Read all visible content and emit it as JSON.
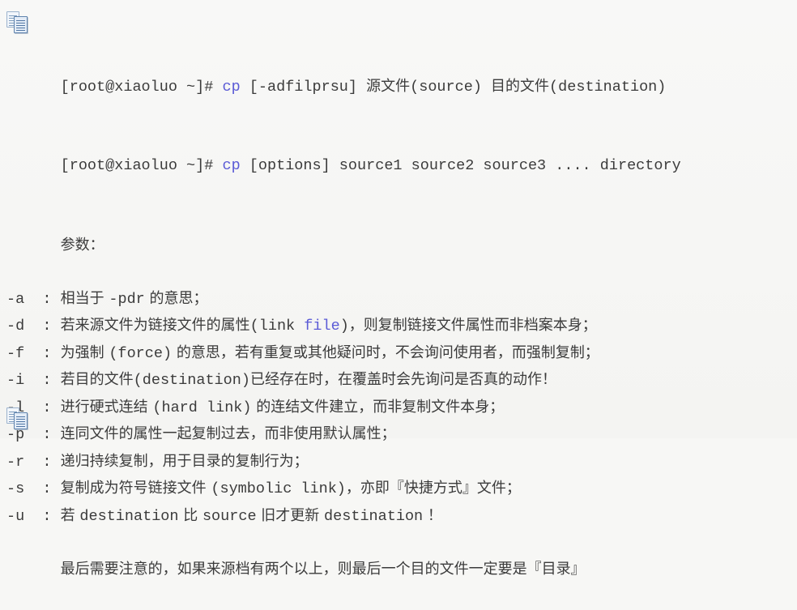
{
  "icons": {
    "top": "copy-icon",
    "bottom": "copy-icon"
  },
  "command_lines": [
    {
      "prompt": "[root@xiaoluo ~]# ",
      "command": "cp",
      "args_mono": " [-adfilprsu] ",
      "args_cjk": "源文件",
      "args_mono2": "(source) ",
      "args_cjk2": "目的文件",
      "args_mono3": "(destination)"
    },
    {
      "prompt": "[root@xiaoluo ~]# ",
      "command": "cp",
      "args_mono": " [options] source1 source2 source3 .... directory"
    }
  ],
  "params_heading": "参数：",
  "params": [
    {
      "flag": "-a",
      "sep": "  : ",
      "parts": [
        {
          "t": "相当于 ",
          "style": "cjk"
        },
        {
          "t": "-pdr",
          "style": "mono"
        },
        {
          "t": " 的意思；",
          "style": "cjk"
        }
      ]
    },
    {
      "flag": "-d",
      "sep": "  : ",
      "parts": [
        {
          "t": "若来源文件为链接文件的属性",
          "style": "cjk"
        },
        {
          "t": "(link ",
          "style": "mono"
        },
        {
          "t": "file",
          "style": "kw"
        },
        {
          "t": ")",
          "style": "mono"
        },
        {
          "t": "，则复制链接文件属性而非档案本身；",
          "style": "cjk"
        }
      ]
    },
    {
      "flag": "-f",
      "sep": "  : ",
      "parts": [
        {
          "t": "为强制 ",
          "style": "cjk"
        },
        {
          "t": "(force)",
          "style": "mono"
        },
        {
          "t": " 的意思，若有重复或其他疑问时，不会询问使用者，而强制复制；",
          "style": "cjk"
        }
      ]
    },
    {
      "flag": "-i",
      "sep": "  : ",
      "parts": [
        {
          "t": "若目的文件",
          "style": "cjk"
        },
        {
          "t": "(destination)",
          "style": "mono"
        },
        {
          "t": "已经存在时，在覆盖时会先询问是否真的动作！",
          "style": "cjk"
        }
      ]
    },
    {
      "flag": "-l",
      "sep": "  : ",
      "parts": [
        {
          "t": "进行硬式连结 ",
          "style": "cjk"
        },
        {
          "t": "(hard link)",
          "style": "mono"
        },
        {
          "t": " 的连结文件建立，而非复制文件本身；",
          "style": "cjk"
        }
      ]
    },
    {
      "flag": "-p",
      "sep": "  : ",
      "parts": [
        {
          "t": "连同文件的属性一起复制过去，而非使用默认属性；",
          "style": "cjk"
        }
      ]
    },
    {
      "flag": "-r",
      "sep": "  : ",
      "parts": [
        {
          "t": "递归持续复制，用于目录的复制行为；",
          "style": "cjk"
        }
      ]
    },
    {
      "flag": "-s",
      "sep": "  : ",
      "parts": [
        {
          "t": "复制成为符号链接文件 ",
          "style": "cjk"
        },
        {
          "t": "(symbolic link)",
          "style": "mono"
        },
        {
          "t": "，亦即『快捷方式』文件；",
          "style": "cjk"
        }
      ]
    },
    {
      "flag": "-u",
      "sep": "  : ",
      "parts": [
        {
          "t": "若 ",
          "style": "cjk"
        },
        {
          "t": "destination",
          "style": "mono"
        },
        {
          "t": " 比 ",
          "style": "cjk"
        },
        {
          "t": "source",
          "style": "mono"
        },
        {
          "t": " 旧才更新 ",
          "style": "cjk"
        },
        {
          "t": "destination",
          "style": "mono"
        },
        {
          "t": " ！",
          "style": "cjk"
        }
      ]
    }
  ],
  "footer_note": "最后需要注意的，如果来源档有两个以上，则最后一个目的文件一定要是『目录』",
  "colors": {
    "background": "#f7f7f5",
    "text": "#3b3b3b",
    "keyword_blue": "#5b5bd6",
    "icon_blue": "#5f83ad"
  }
}
